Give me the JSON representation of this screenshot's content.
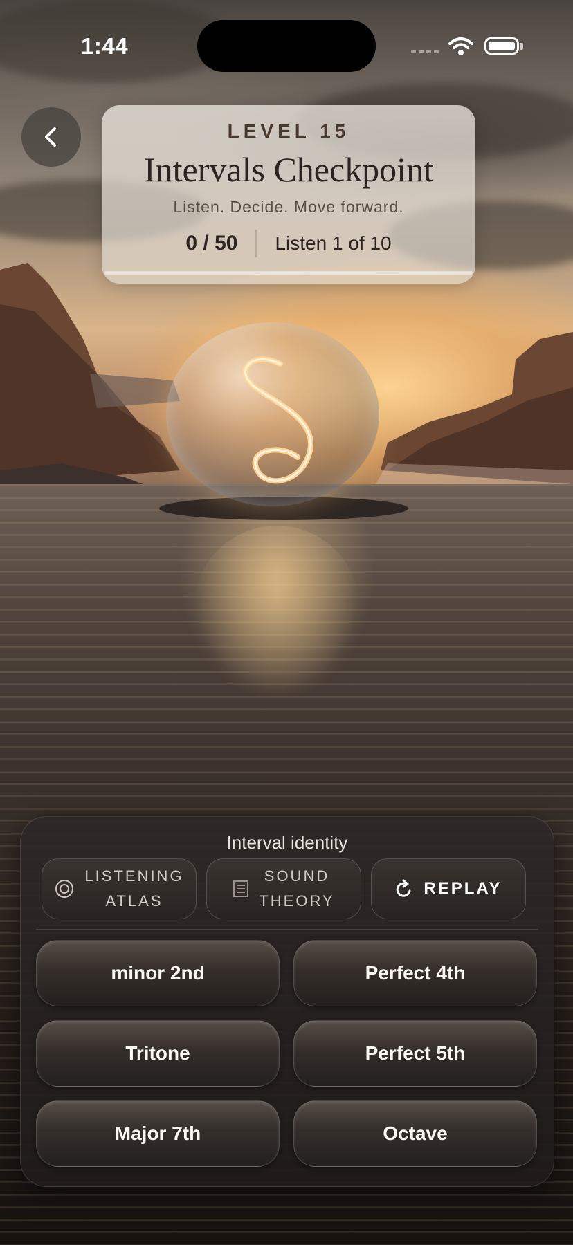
{
  "status_bar": {
    "time": "1:44"
  },
  "header": {
    "level": "LEVEL 15",
    "title": "Intervals Checkpoint",
    "subtitle": "Listen. Decide. Move forward.",
    "score": "0 / 50",
    "listen_progress": "Listen 1 of 10",
    "progress_fraction": 0.0
  },
  "panel": {
    "title": "Interval identity",
    "tools": [
      {
        "label_line1": "LISTENING",
        "label_line2": "ATLAS",
        "icon": "target-icon"
      },
      {
        "label_line1": "SOUND",
        "label_line2": "THEORY",
        "icon": "book-icon"
      },
      {
        "label": "REPLAY",
        "icon": "replay-icon"
      }
    ],
    "answers": [
      "minor 2nd",
      "Perfect 4th",
      "Tritone",
      "Perfect 5th",
      "Major 7th",
      "Octave"
    ]
  },
  "colors": {
    "accent": "#c98a4a",
    "panel_bg": "#2d2826",
    "header_bg": "#f2ede6"
  }
}
